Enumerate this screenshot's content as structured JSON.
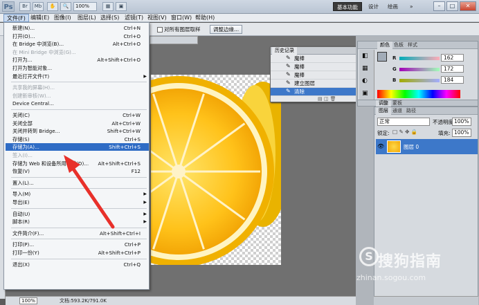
{
  "titlebar": {
    "logo": "Ps",
    "zoom": "100%",
    "workspaces": [
      "基本功能",
      "设计",
      "绘画",
      "»"
    ],
    "window_buttons": [
      "–",
      "□",
      "✕"
    ]
  },
  "menubar": [
    "文件(F)",
    "编辑(E)",
    "图像(I)",
    "图层(L)",
    "选择(S)",
    "滤镜(T)",
    "视图(V)",
    "窗口(W)",
    "帮助(H)"
  ],
  "options": {
    "sample_all_layers": "对所有图层取样",
    "refine_edge": "调整边缘..."
  },
  "file_menu": [
    {
      "label": "新建(N)...",
      "shortcut": "Ctrl+N"
    },
    {
      "label": "打开(O)...",
      "shortcut": "Ctrl+O"
    },
    {
      "label": "在 Bridge 中浏览(B)...",
      "shortcut": "Alt+Ctrl+O"
    },
    {
      "label": "在 Mini Bridge 中浏览(G)...",
      "shortcut": "",
      "disabled": true
    },
    {
      "label": "打开为...",
      "shortcut": "Alt+Shift+Ctrl+O"
    },
    {
      "label": "打开为智能对象...",
      "shortcut": ""
    },
    {
      "label": "最近打开文件(T)",
      "shortcut": "",
      "submenu": true
    },
    {
      "sep": true
    },
    {
      "label": "共享我的屏幕(H)...",
      "shortcut": "",
      "disabled": true
    },
    {
      "label": "创建新审核(W)...",
      "shortcut": "",
      "disabled": true
    },
    {
      "label": "Device Central...",
      "shortcut": ""
    },
    {
      "sep": true
    },
    {
      "label": "关闭(C)",
      "shortcut": "Ctrl+W"
    },
    {
      "label": "关闭全部",
      "shortcut": "Alt+Ctrl+W"
    },
    {
      "label": "关闭并转到 Bridge...",
      "shortcut": "Shift+Ctrl+W"
    },
    {
      "label": "存储(S)",
      "shortcut": "Ctrl+S"
    },
    {
      "label": "存储为(A)...",
      "shortcut": "Shift+Ctrl+S",
      "highlight": true
    },
    {
      "label": "签入(I)...",
      "shortcut": "",
      "disabled": true
    },
    {
      "label": "存储为 Web 和设备所用格式(D)...",
      "shortcut": "Alt+Shift+Ctrl+S"
    },
    {
      "label": "恢复(V)",
      "shortcut": "F12"
    },
    {
      "sep": true
    },
    {
      "label": "置入(L)...",
      "shortcut": ""
    },
    {
      "sep": true
    },
    {
      "label": "导入(M)",
      "shortcut": "",
      "submenu": true
    },
    {
      "label": "导出(E)",
      "shortcut": "",
      "submenu": true
    },
    {
      "sep": true
    },
    {
      "label": "自动(U)",
      "shortcut": "",
      "submenu": true
    },
    {
      "label": "脚本(R)",
      "shortcut": "",
      "submenu": true
    },
    {
      "sep": true
    },
    {
      "label": "文件简介(F)...",
      "shortcut": "Alt+Shift+Ctrl+I"
    },
    {
      "sep": true
    },
    {
      "label": "打印(P)...",
      "shortcut": "Ctrl+P"
    },
    {
      "label": "打印一份(Y)",
      "shortcut": "Alt+Shift+Ctrl+P"
    },
    {
      "sep": true
    },
    {
      "label": "退出(X)",
      "shortcut": "Ctrl+Q"
    }
  ],
  "history": {
    "title": "历史记录",
    "items": [
      {
        "label": "魔棒"
      },
      {
        "label": "魔棒"
      },
      {
        "label": "魔棒"
      },
      {
        "label": "建立图层"
      },
      {
        "label": "清除",
        "selected": true
      }
    ]
  },
  "color_panel": {
    "tabs": [
      "颜色",
      "色板",
      "样式"
    ],
    "R": {
      "label": "R",
      "value": "162"
    },
    "G": {
      "label": "G",
      "value": "172"
    },
    "B": {
      "label": "B",
      "value": "184"
    },
    "swatch": "#a2acb8"
  },
  "layers_panel": {
    "tabs": [
      "图层",
      "通道",
      "路径"
    ],
    "blend_mode": "正常",
    "opacity_label": "不透明度:",
    "opacity": "100%",
    "lock_label": "锁定:",
    "fill_label": "填充:",
    "fill": "100%",
    "layer_name": "图层 0"
  },
  "adjust_tabs": [
    "调整",
    "蒙板"
  ],
  "status": {
    "zoom": "100%",
    "doc": "文档:593.2K/791.0K"
  },
  "watermark": {
    "icon": "S",
    "title": "搜狗指南",
    "url": "zhinan.sogou.com"
  }
}
